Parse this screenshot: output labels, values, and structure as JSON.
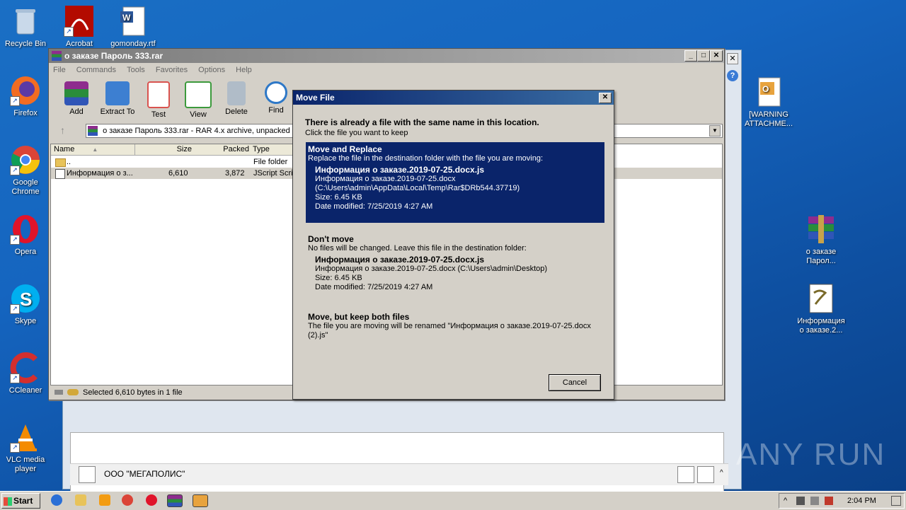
{
  "desktop": {
    "left_icons": [
      {
        "label": "Recycle Bin",
        "icon": "recycle-bin-icon"
      },
      {
        "label": "Firefox",
        "icon": "firefox-icon"
      },
      {
        "label": "Google Chrome",
        "icon": "chrome-icon"
      },
      {
        "label": "Opera",
        "icon": "opera-icon"
      },
      {
        "label": "Skype",
        "icon": "skype-icon"
      },
      {
        "label": "CCleaner",
        "icon": "ccleaner-icon"
      },
      {
        "label": "VLC media player",
        "icon": "vlc-icon"
      }
    ],
    "top_icons": [
      {
        "label": "Acrobat",
        "icon": "acrobat-icon"
      },
      {
        "label": "gomonday.rtf",
        "icon": "word-doc-icon"
      }
    ],
    "right_icons": [
      {
        "label": "[WARNING ATTACHME...",
        "icon": "outlook-attachment-icon"
      },
      {
        "label": "о заказе Парол...",
        "icon": "winrar-archive-icon"
      },
      {
        "label": "Информация о заказе.2...",
        "icon": "script-file-icon"
      }
    ]
  },
  "background_window": {
    "contact_name": "ООО \"МЕГАПОЛИС\""
  },
  "winrar": {
    "title": "о заказе Пароль 333.rar",
    "menu": [
      "File",
      "Commands",
      "Tools",
      "Favorites",
      "Options",
      "Help"
    ],
    "toolbar": [
      {
        "label": "Add",
        "icon": "add-icon",
        "color": "#c0392b"
      },
      {
        "label": "Extract To",
        "icon": "extract-folder-icon",
        "color": "#3d7fd1"
      },
      {
        "label": "Test",
        "icon": "test-checklist-icon",
        "color": "#d9534f"
      },
      {
        "label": "View",
        "icon": "view-book-icon",
        "color": "#3c9a3c"
      },
      {
        "label": "Delete",
        "icon": "delete-trash-icon",
        "color": "#8a9aa8"
      },
      {
        "label": "Find",
        "icon": "find-magnifier-icon",
        "color": "#2e78c7"
      }
    ],
    "address": "о заказе Пароль 333.rar - RAR 4.x archive, unpacked",
    "columns": [
      "Name",
      "Size",
      "Packed",
      "Type"
    ],
    "rows": [
      {
        "name": "..",
        "size": "",
        "packed": "",
        "type": "File folder"
      },
      {
        "name": "Информация о з...",
        "size": "6,610",
        "packed": "3,872",
        "type": "JScript Scrip"
      }
    ],
    "status": "Selected 6,610 bytes in 1 file"
  },
  "dialog": {
    "title": "Move File",
    "heading": "There is already a file with the same name in this location.",
    "subheading": "Click the file you want to keep",
    "option_replace": {
      "title": "Move and Replace",
      "desc": "Replace the file in the destination folder with the file you are moving:",
      "file": "Информация о заказе.2019-07-25.docx.js",
      "line1": "Информация о заказе.2019-07-25.docx",
      "line2": "(C:\\Users\\admin\\AppData\\Local\\Temp\\Rar$DRb544.37719)",
      "size": "Size: 6.45 KB",
      "date": "Date modified: 7/25/2019 4:27 AM"
    },
    "option_dont": {
      "title": "Don't move",
      "desc": "No files will be changed. Leave this file in the destination folder:",
      "file": "Информация о заказе.2019-07-25.docx.js",
      "line1": "Информация о заказе.2019-07-25.docx (C:\\Users\\admin\\Desktop)",
      "size": "Size: 6.45 KB",
      "date": "Date modified: 7/25/2019 4:27 AM"
    },
    "option_both": {
      "title": "Move, but keep both files",
      "desc": "The file you are moving will be renamed \"Информация о заказе.2019-07-25.docx (2).js\""
    },
    "cancel_label": "Cancel"
  },
  "taskbar": {
    "start_label": "Start",
    "clock": "2:04 PM"
  },
  "watermark": "ANY RUN"
}
